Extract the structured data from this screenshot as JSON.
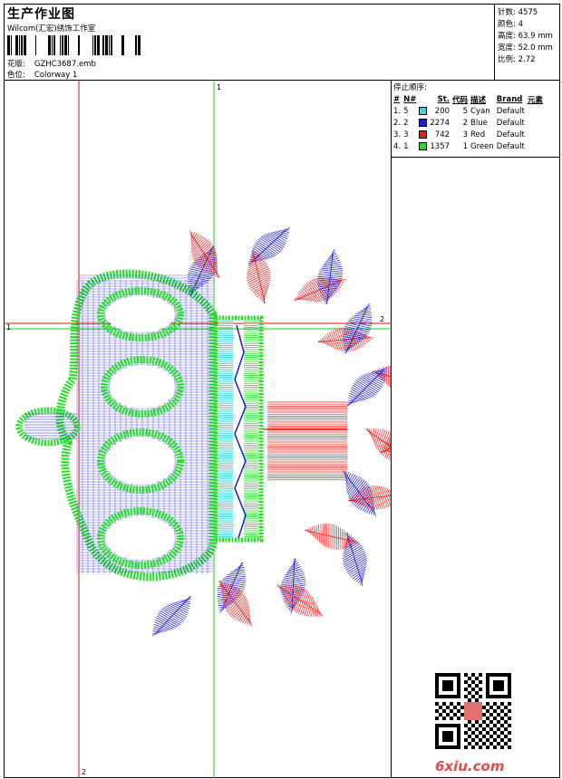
{
  "header": {
    "title": "生产作业图",
    "company": "Wilcom(汇宏)绣饰工作室",
    "design_label": "花版:",
    "design_value": "GZHC3687.emb",
    "colorway_label": "色位:",
    "colorway_value": "Colorway 1"
  },
  "stats": [
    {
      "label": "针数:",
      "value": "4575"
    },
    {
      "label": "颜色:",
      "value": "4"
    },
    {
      "label": "高度:",
      "value": "63.9 mm"
    },
    {
      "label": "宽度:",
      "value": "52.0 mm"
    },
    {
      "label": "比例:",
      "value": "2.72"
    }
  ],
  "stop_sequence": {
    "title": "停止顺序:",
    "columns": [
      "#",
      "N#",
      "St.",
      "代码",
      "描述",
      "Brand",
      "元素"
    ],
    "rows": [
      {
        "idx": "1.",
        "n": "5",
        "color": "#35d6e0",
        "st": "200",
        "code": "5",
        "desc": "Cyan",
        "brand": "Default"
      },
      {
        "idx": "2.",
        "n": "2",
        "color": "#1a1ad6",
        "st": "2274",
        "code": "2",
        "desc": "Blue",
        "brand": "Default"
      },
      {
        "idx": "3.",
        "n": "3",
        "color": "#e61e1e",
        "st": "742",
        "code": "3",
        "desc": "Red",
        "brand": "Default"
      },
      {
        "idx": "4.",
        "n": "1",
        "color": "#22e022",
        "st": "1357",
        "code": "1",
        "desc": "Green",
        "brand": "Default"
      }
    ]
  },
  "guides": {
    "v1": "1",
    "v2": "2",
    "h1": "1",
    "h2": "2"
  },
  "watermark": "6xiu.com",
  "colors": {
    "cyan": "#35d6e0",
    "blue": "#1a1ad6",
    "red": "#e61e1e",
    "green": "#22e022",
    "guide_green": "#22cc22",
    "guide_red": "#e01010"
  }
}
